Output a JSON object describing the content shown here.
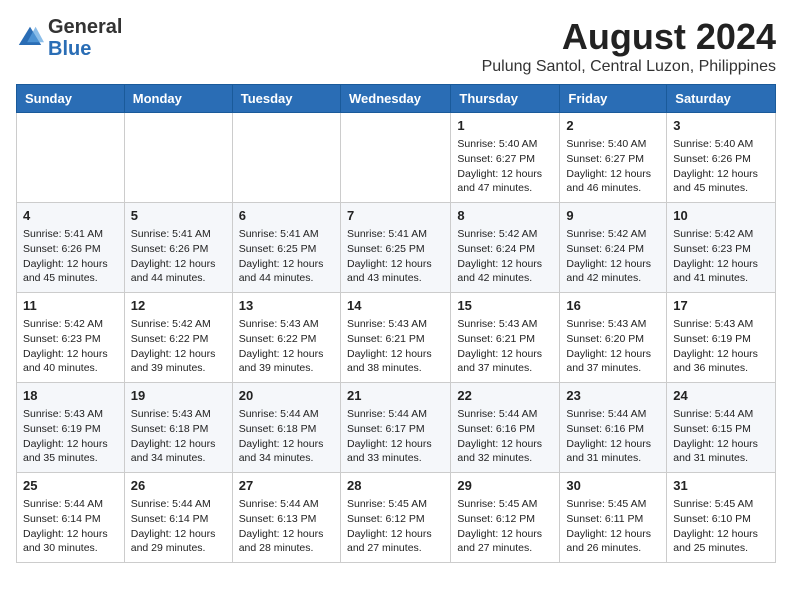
{
  "header": {
    "logo_general": "General",
    "logo_blue": "Blue",
    "month_year": "August 2024",
    "location": "Pulung Santol, Central Luzon, Philippines"
  },
  "days_of_week": [
    "Sunday",
    "Monday",
    "Tuesday",
    "Wednesday",
    "Thursday",
    "Friday",
    "Saturday"
  ],
  "weeks": [
    [
      {
        "day": "",
        "info": ""
      },
      {
        "day": "",
        "info": ""
      },
      {
        "day": "",
        "info": ""
      },
      {
        "day": "",
        "info": ""
      },
      {
        "day": "1",
        "info": "Sunrise: 5:40 AM\nSunset: 6:27 PM\nDaylight: 12 hours\nand 47 minutes."
      },
      {
        "day": "2",
        "info": "Sunrise: 5:40 AM\nSunset: 6:27 PM\nDaylight: 12 hours\nand 46 minutes."
      },
      {
        "day": "3",
        "info": "Sunrise: 5:40 AM\nSunset: 6:26 PM\nDaylight: 12 hours\nand 45 minutes."
      }
    ],
    [
      {
        "day": "4",
        "info": "Sunrise: 5:41 AM\nSunset: 6:26 PM\nDaylight: 12 hours\nand 45 minutes."
      },
      {
        "day": "5",
        "info": "Sunrise: 5:41 AM\nSunset: 6:26 PM\nDaylight: 12 hours\nand 44 minutes."
      },
      {
        "day": "6",
        "info": "Sunrise: 5:41 AM\nSunset: 6:25 PM\nDaylight: 12 hours\nand 44 minutes."
      },
      {
        "day": "7",
        "info": "Sunrise: 5:41 AM\nSunset: 6:25 PM\nDaylight: 12 hours\nand 43 minutes."
      },
      {
        "day": "8",
        "info": "Sunrise: 5:42 AM\nSunset: 6:24 PM\nDaylight: 12 hours\nand 42 minutes."
      },
      {
        "day": "9",
        "info": "Sunrise: 5:42 AM\nSunset: 6:24 PM\nDaylight: 12 hours\nand 42 minutes."
      },
      {
        "day": "10",
        "info": "Sunrise: 5:42 AM\nSunset: 6:23 PM\nDaylight: 12 hours\nand 41 minutes."
      }
    ],
    [
      {
        "day": "11",
        "info": "Sunrise: 5:42 AM\nSunset: 6:23 PM\nDaylight: 12 hours\nand 40 minutes."
      },
      {
        "day": "12",
        "info": "Sunrise: 5:42 AM\nSunset: 6:22 PM\nDaylight: 12 hours\nand 39 minutes."
      },
      {
        "day": "13",
        "info": "Sunrise: 5:43 AM\nSunset: 6:22 PM\nDaylight: 12 hours\nand 39 minutes."
      },
      {
        "day": "14",
        "info": "Sunrise: 5:43 AM\nSunset: 6:21 PM\nDaylight: 12 hours\nand 38 minutes."
      },
      {
        "day": "15",
        "info": "Sunrise: 5:43 AM\nSunset: 6:21 PM\nDaylight: 12 hours\nand 37 minutes."
      },
      {
        "day": "16",
        "info": "Sunrise: 5:43 AM\nSunset: 6:20 PM\nDaylight: 12 hours\nand 37 minutes."
      },
      {
        "day": "17",
        "info": "Sunrise: 5:43 AM\nSunset: 6:19 PM\nDaylight: 12 hours\nand 36 minutes."
      }
    ],
    [
      {
        "day": "18",
        "info": "Sunrise: 5:43 AM\nSunset: 6:19 PM\nDaylight: 12 hours\nand 35 minutes."
      },
      {
        "day": "19",
        "info": "Sunrise: 5:43 AM\nSunset: 6:18 PM\nDaylight: 12 hours\nand 34 minutes."
      },
      {
        "day": "20",
        "info": "Sunrise: 5:44 AM\nSunset: 6:18 PM\nDaylight: 12 hours\nand 34 minutes."
      },
      {
        "day": "21",
        "info": "Sunrise: 5:44 AM\nSunset: 6:17 PM\nDaylight: 12 hours\nand 33 minutes."
      },
      {
        "day": "22",
        "info": "Sunrise: 5:44 AM\nSunset: 6:16 PM\nDaylight: 12 hours\nand 32 minutes."
      },
      {
        "day": "23",
        "info": "Sunrise: 5:44 AM\nSunset: 6:16 PM\nDaylight: 12 hours\nand 31 minutes."
      },
      {
        "day": "24",
        "info": "Sunrise: 5:44 AM\nSunset: 6:15 PM\nDaylight: 12 hours\nand 31 minutes."
      }
    ],
    [
      {
        "day": "25",
        "info": "Sunrise: 5:44 AM\nSunset: 6:14 PM\nDaylight: 12 hours\nand 30 minutes."
      },
      {
        "day": "26",
        "info": "Sunrise: 5:44 AM\nSunset: 6:14 PM\nDaylight: 12 hours\nand 29 minutes."
      },
      {
        "day": "27",
        "info": "Sunrise: 5:44 AM\nSunset: 6:13 PM\nDaylight: 12 hours\nand 28 minutes."
      },
      {
        "day": "28",
        "info": "Sunrise: 5:45 AM\nSunset: 6:12 PM\nDaylight: 12 hours\nand 27 minutes."
      },
      {
        "day": "29",
        "info": "Sunrise: 5:45 AM\nSunset: 6:12 PM\nDaylight: 12 hours\nand 27 minutes."
      },
      {
        "day": "30",
        "info": "Sunrise: 5:45 AM\nSunset: 6:11 PM\nDaylight: 12 hours\nand 26 minutes."
      },
      {
        "day": "31",
        "info": "Sunrise: 5:45 AM\nSunset: 6:10 PM\nDaylight: 12 hours\nand 25 minutes."
      }
    ]
  ]
}
